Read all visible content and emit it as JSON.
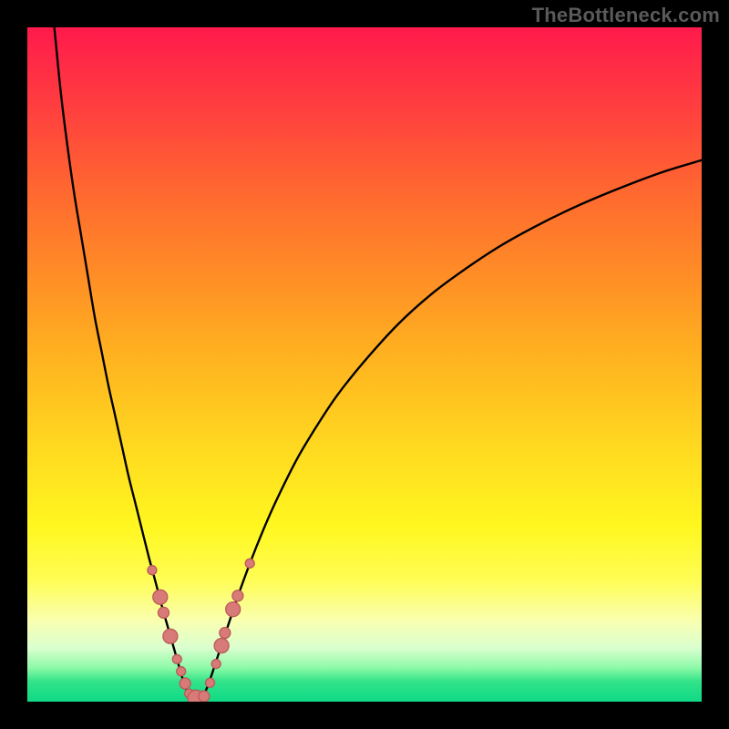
{
  "watermark": "TheBottleneck.com",
  "chart_data": {
    "type": "line",
    "title": "",
    "xlabel": "",
    "ylabel": "",
    "xlim": [
      0,
      100
    ],
    "ylim": [
      0,
      100
    ],
    "grid": false,
    "legend": false,
    "series": [
      {
        "name": "left-branch",
        "x": [
          4,
          5,
          6,
          7,
          8,
          9,
          10,
          11,
          12,
          13,
          14,
          15,
          16,
          17,
          18,
          19,
          20,
          21,
          22,
          23,
          24
        ],
        "y": [
          100,
          90,
          82,
          75,
          69,
          63,
          57,
          52,
          47,
          42.5,
          38,
          33.5,
          29.5,
          25.5,
          21.5,
          17.8,
          14,
          10.5,
          7,
          3.5,
          0.5
        ]
      },
      {
        "name": "right-branch",
        "x": [
          26,
          27,
          28,
          29,
          30,
          31,
          33,
          35,
          37,
          40,
          43,
          46,
          50,
          55,
          60,
          65,
          70,
          75,
          80,
          85,
          90,
          95,
          100
        ],
        "y": [
          0.5,
          3,
          6,
          9,
          12,
          15,
          20.5,
          25.5,
          30,
          36,
          41,
          45.5,
          50.5,
          56,
          60.5,
          64.2,
          67.5,
          70.3,
          72.8,
          75,
          77,
          78.8,
          80.3
        ]
      }
    ],
    "markers": {
      "name": "highlighted-points",
      "color": "#d87b78",
      "points": [
        {
          "x": 18.5,
          "y": 19.5,
          "r": 5
        },
        {
          "x": 19.7,
          "y": 15.5,
          "r": 8
        },
        {
          "x": 20.2,
          "y": 13.2,
          "r": 6
        },
        {
          "x": 21.2,
          "y": 9.7,
          "r": 8
        },
        {
          "x": 22.2,
          "y": 6.3,
          "r": 5
        },
        {
          "x": 22.8,
          "y": 4.5,
          "r": 5
        },
        {
          "x": 23.4,
          "y": 2.7,
          "r": 6
        },
        {
          "x": 24.0,
          "y": 1.2,
          "r": 5
        },
        {
          "x": 25.0,
          "y": 0.5,
          "r": 9
        },
        {
          "x": 26.2,
          "y": 0.8,
          "r": 6
        },
        {
          "x": 27.1,
          "y": 2.8,
          "r": 5
        },
        {
          "x": 28.0,
          "y": 5.6,
          "r": 5
        },
        {
          "x": 28.8,
          "y": 8.3,
          "r": 8
        },
        {
          "x": 29.3,
          "y": 10.2,
          "r": 6
        },
        {
          "x": 30.5,
          "y": 13.7,
          "r": 8
        },
        {
          "x": 31.2,
          "y": 15.7,
          "r": 6
        },
        {
          "x": 33.0,
          "y": 20.5,
          "r": 5
        }
      ]
    }
  }
}
